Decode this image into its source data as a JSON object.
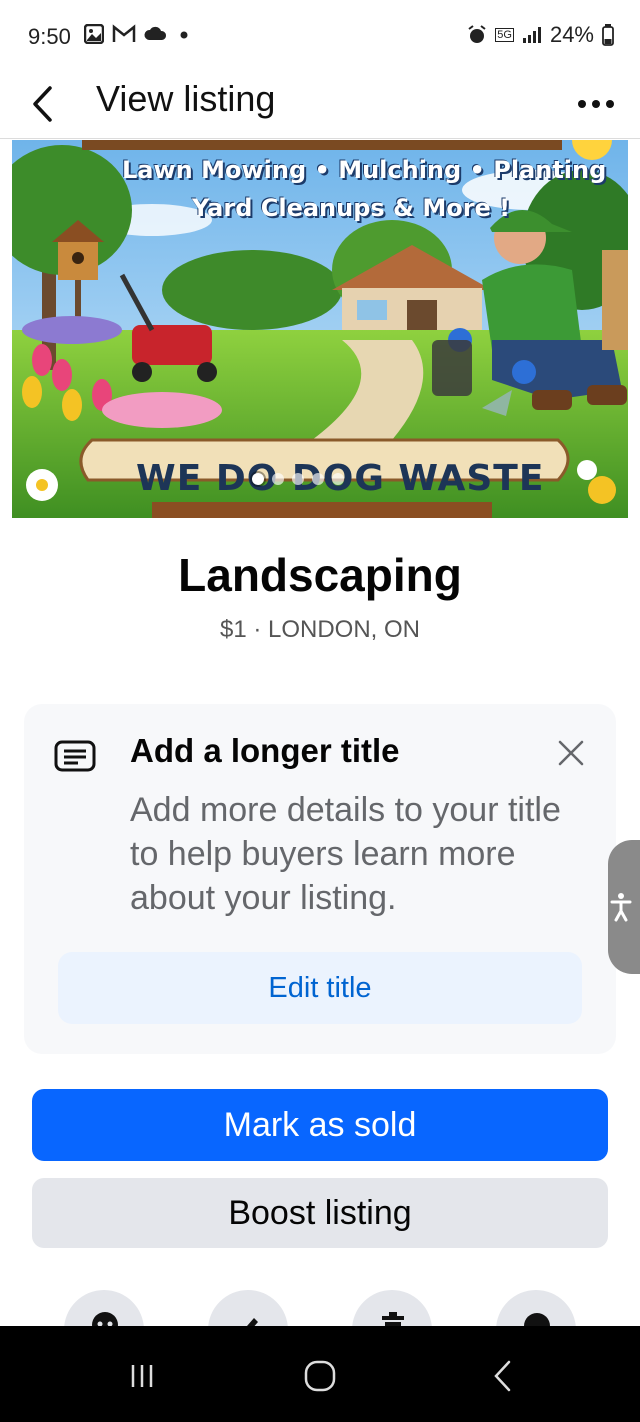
{
  "status_bar": {
    "time": "9:50",
    "battery": "24%",
    "network": "5G",
    "left_icons": [
      "gallery-icon",
      "gmail-icon",
      "cloud-icon",
      "dot-icon"
    ],
    "right_icons": [
      "alarm-icon",
      "5g-icon",
      "signal-icon",
      "battery-icon"
    ]
  },
  "header": {
    "title": "View listing",
    "back_icon": "chevron-left-icon",
    "more_icon": "more-horizontal-icon"
  },
  "hero": {
    "line1": "Lawn Mowing • Mulching • Planting",
    "line2": "Yard Cleanups & More !",
    "banner_text": "WE DO DOG WASTE",
    "carousel": {
      "count": 5,
      "active_index": 0
    }
  },
  "listing": {
    "title": "Landscaping",
    "meta": "$1 · LONDON, ON"
  },
  "tip_card": {
    "heading": "Add a longer title",
    "body": "Add more details to your title to help buyers learn more about your listing.",
    "button_label": "Edit title",
    "icon": "text-box-icon",
    "close_icon": "close-icon"
  },
  "actions": {
    "mark_sold_label": "Mark as sold",
    "boost_label": "Boost listing",
    "icons": [
      "message-icon",
      "pencil-icon",
      "trash-icon",
      "more-icon"
    ]
  },
  "colors": {
    "primary": "#0866ff",
    "link": "#0064d1",
    "secondary_button": "#e4e6eb",
    "card_bg": "#f7f8fa"
  }
}
